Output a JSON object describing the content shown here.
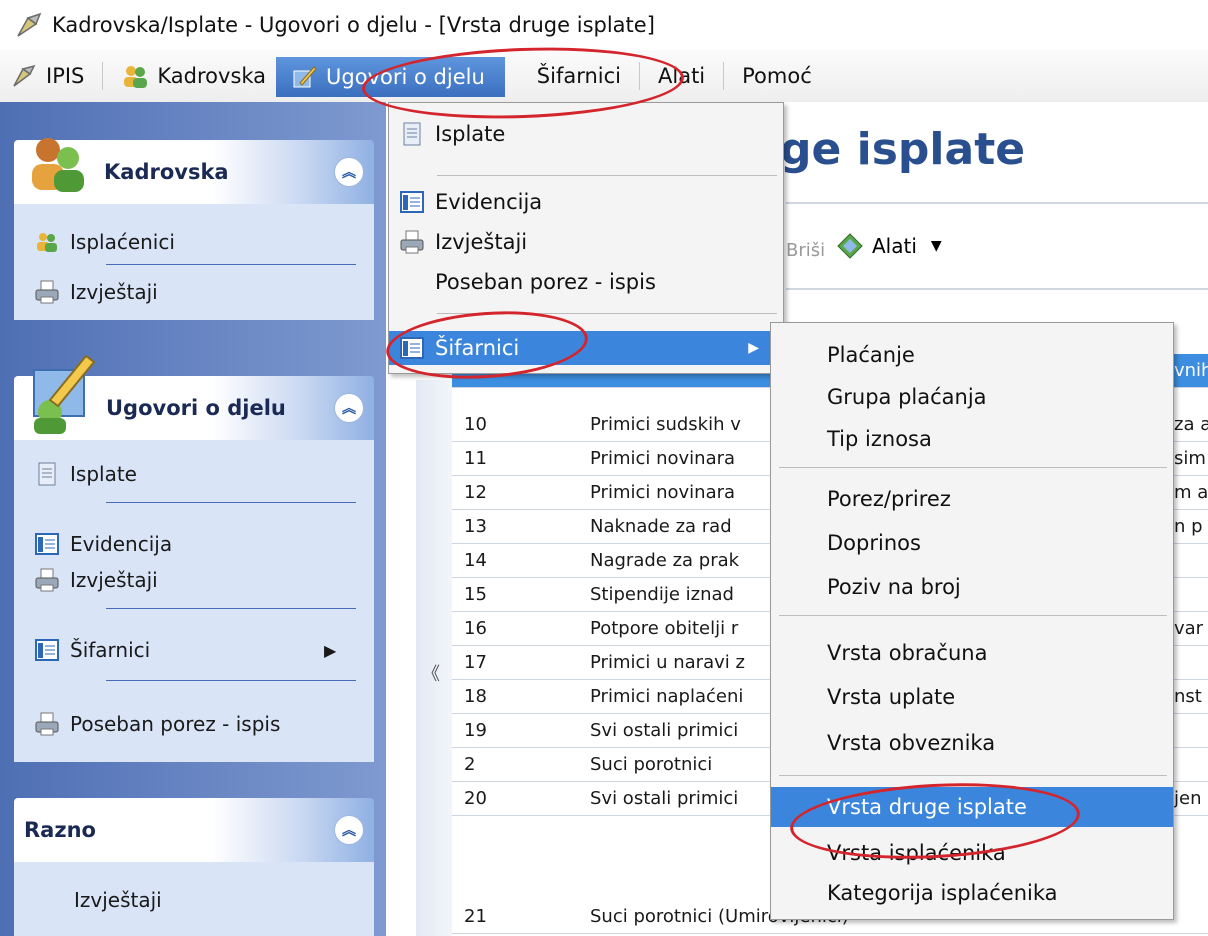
{
  "window": {
    "title": "Kadrovska/Isplate - Ugovori o djelu - [Vrsta druge isplate]"
  },
  "menubar": {
    "items": [
      "IPIS",
      "Kadrovska",
      "Ugovori o djelu",
      "Šifarnici",
      "Alati",
      "Pomoć"
    ],
    "active": "Ugovori o djelu"
  },
  "leftnav": {
    "groups": [
      {
        "title": "Kadrovska",
        "items": [
          "Isplaćenici",
          "Izvještaji"
        ]
      },
      {
        "title": "Ugovori o djelu",
        "items": [
          "Isplate",
          "Evidencija",
          "Izvještaji",
          "Šifarnici",
          "Poseban porez - ispis"
        ]
      },
      {
        "title": "Razno",
        "items": [
          "Izvještaji"
        ]
      }
    ]
  },
  "main": {
    "title_fragment": "ge isplate",
    "toolbar": {
      "delete_label": "Briši",
      "tools_label": "Alati"
    },
    "rows": [
      {
        "id": "10",
        "name": "Primici sudskih v",
        "extra": "za a"
      },
      {
        "id": "11",
        "name": "Primici novinara",
        "extra": "sim"
      },
      {
        "id": "12",
        "name": "Primici novinara",
        "extra": "m a"
      },
      {
        "id": "13",
        "name": "Naknade za rad",
        "extra": "n p"
      },
      {
        "id": "14",
        "name": "Nagrade za prak",
        "extra": ""
      },
      {
        "id": "15",
        "name": "Stipendije iznad",
        "extra": ""
      },
      {
        "id": "16",
        "name": "Potpore obitelji r",
        "extra": "var"
      },
      {
        "id": "17",
        "name": "Primici u naravi z",
        "extra": ""
      },
      {
        "id": "18",
        "name": "Primici naplaćeni",
        "extra": "nst"
      },
      {
        "id": "19",
        "name": "Svi ostali primici",
        "extra": ""
      },
      {
        "id": "2",
        "name": "Suci porotnici",
        "extra": ""
      },
      {
        "id": "20",
        "name": "Svi ostali primici",
        "extra": "jen"
      },
      {
        "id": "21",
        "name": "Suci porotnici (Umirovljenici)",
        "extra": ""
      }
    ],
    "selected_row_extra": "vnih"
  },
  "dropdown": {
    "items": [
      "Isplate",
      "Evidencija",
      "Izvještaji",
      "Poseban porez - ispis",
      "Šifarnici"
    ],
    "highlighted": "Šifarnici"
  },
  "submenu": {
    "items": [
      "Plaćanje",
      "Grupa plaćanja",
      "Tip iznosa",
      "Porez/prirez",
      "Doprinos",
      "Poziv na broj",
      "Vrsta obračuna",
      "Vrsta uplate",
      "Vrsta obveznika",
      "Vrsta druge isplate",
      "Vrsta isplaćenika",
      "Kategorija isplaćenika"
    ],
    "highlighted": "Vrsta druge isplate"
  },
  "colors": {
    "accent": "#3b86dc",
    "annotation": "#d4242c",
    "nav": "#4f6fb4"
  }
}
